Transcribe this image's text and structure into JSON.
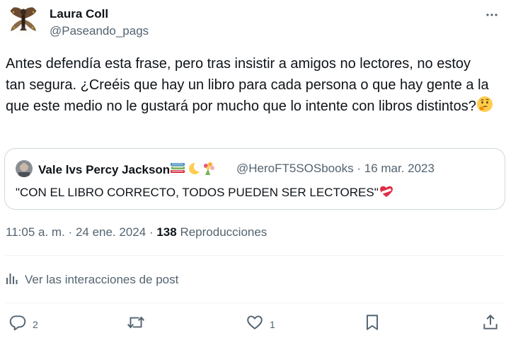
{
  "author": {
    "name": "Laura Coll",
    "handle": "@Paseando_pags"
  },
  "tweet": {
    "text": "Antes defendía esta frase, pero tras insistir a amigos no lectores, no estoy tan segura. ¿Creéis que hay un libro para cada persona o que hay gente a la que este medio no le gustará por mucho que lo intente con libros distintos?",
    "trailing_emoji": "thinking-face-emoji"
  },
  "quote": {
    "name": "Vale lvs Percy Jackson",
    "name_emojis": [
      "books-emoji",
      "crescent-moon-emoji",
      "bouquet-emoji"
    ],
    "handle": "@HeroFT5SOSbooks",
    "separator": "·",
    "date": "16 mar. 2023",
    "text": "\"CON EL LIBRO CORRECTO, TODOS PUEDEN SER LECTORES\"",
    "trailing_emoji": "mending-heart-emoji"
  },
  "meta": {
    "time": "11:05 a. m.",
    "separator": "·",
    "date": "24 ene. 2024",
    "views_count": "138",
    "views_label": "Reproducciones"
  },
  "interactions": {
    "label": "Ver las interacciones de post"
  },
  "actions": {
    "reply_count": "2",
    "retweet_count": "",
    "like_count": "1"
  },
  "colors": {
    "text": "#0f1419",
    "secondary": "#536471",
    "border": "#cfd9de",
    "divider": "#eff3f4"
  }
}
